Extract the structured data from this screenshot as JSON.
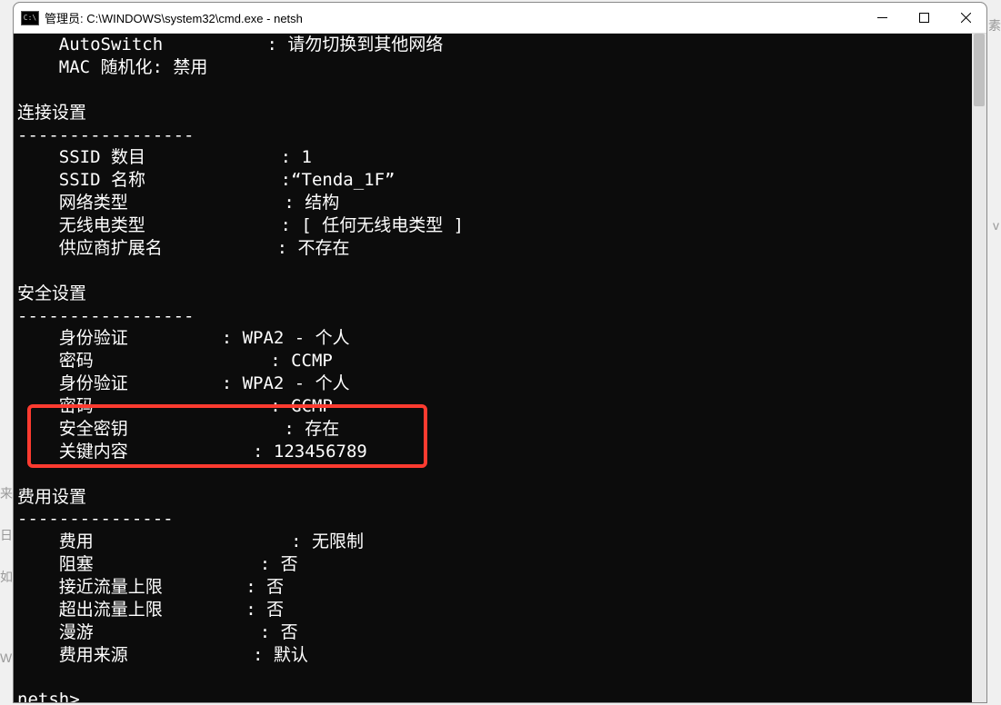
{
  "window": {
    "title": "管理员: C:\\WINDOWS\\system32\\cmd.exe - netsh"
  },
  "terminal": {
    "autoswitch_label": "    AutoSwitch",
    "autoswitch_value": ": 请勿切换到其他网络",
    "mac_random_label": "    MAC 随机化: 禁用",
    "conn_header": "连接设置",
    "divider17": "-----------------",
    "divider15": "---------------",
    "ssid_count_label": "    SSID 数目",
    "ssid_count_value": ": 1",
    "ssid_name_label": "    SSID 名称",
    "ssid_name_value": ":“Tenda_1F”",
    "network_type_label": "    网络类型",
    "network_type_value": ": 结构",
    "radio_type_label": "    无线电类型",
    "radio_type_value": ": [ 任何无线电类型 ]",
    "vendor_ext_label": "    供应商扩展名",
    "vendor_ext_value": ": 不存在",
    "security_header": "安全设置",
    "auth1_label": "    身份验证",
    "auth1_value": ": WPA2 - 个人",
    "cipher1_label": "    密码",
    "cipher1_value": ": CCMP",
    "auth2_label": "    身份验证",
    "auth2_value": ": WPA2 - 个人",
    "cipher2_label": "    密码",
    "cipher2_value": ": GCMP",
    "sec_key_label": "    安全密钥",
    "sec_key_value": ": 存在",
    "key_content_label": "    关键内容",
    "key_content_value": ": 123456789",
    "cost_header": "费用设置",
    "cost_label": "    费用",
    "cost_value": ": 无限制",
    "congested_label": "    阻塞",
    "congested_value": ": 否",
    "near_limit_label": "    接近流量上限",
    "near_limit_value": ": 否",
    "over_limit_label": "    超出流量上限",
    "over_limit_value": ": 否",
    "roaming_label": "    漫游",
    "roaming_value": ": 否",
    "cost_source_label": "    费用来源",
    "cost_source_value": ": 默认",
    "prompt": "netsh>"
  },
  "bg": {
    "lai": "来",
    "ri": "日",
    "ru": "如",
    "w": "W",
    "v": "v",
    "su": "素"
  }
}
